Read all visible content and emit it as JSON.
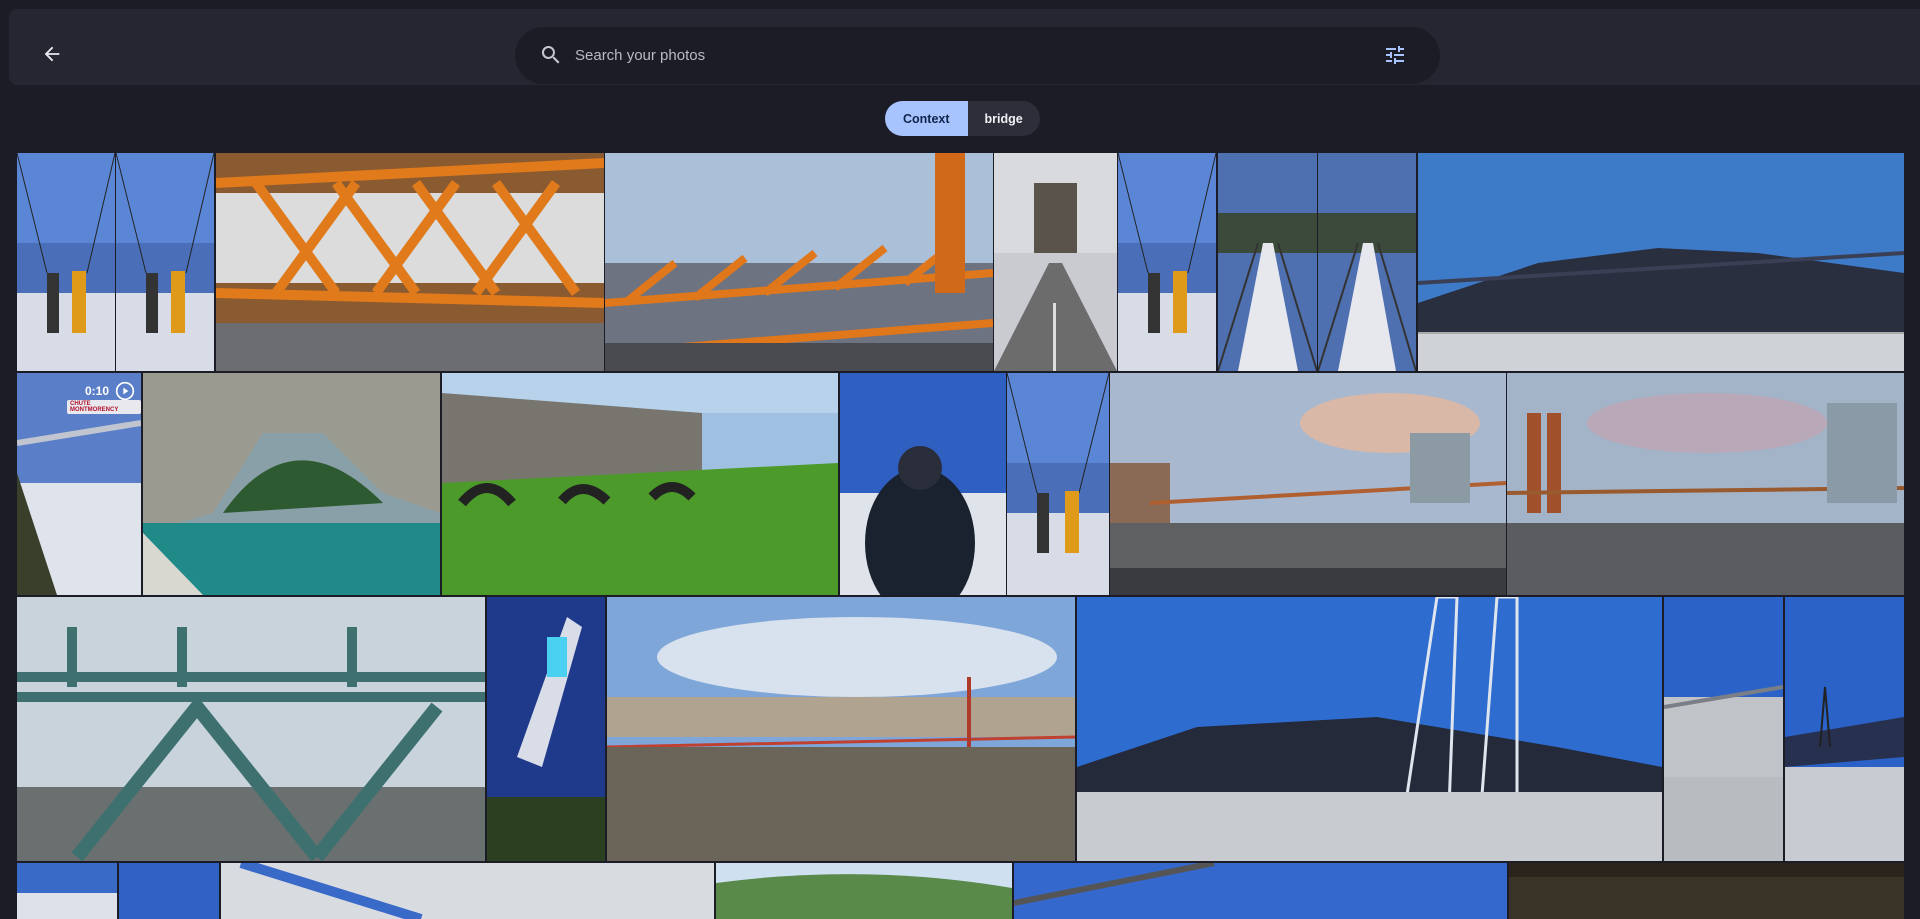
{
  "header": {
    "search_placeholder": "Search your photos"
  },
  "chips": [
    {
      "label": "Context"
    },
    {
      "label": "bridge"
    }
  ],
  "video": {
    "duration": "0:10",
    "tag": "CHUTE MONTMORENCY"
  },
  "colors": {
    "background": "#1b1c26",
    "topbar": "#252632",
    "chip_active": "#a8c4ff",
    "chip_inactive": "#2d2e3a"
  },
  "icons": [
    "back-arrow-icon",
    "search-icon",
    "tune-icon",
    "play-circle-icon"
  ]
}
